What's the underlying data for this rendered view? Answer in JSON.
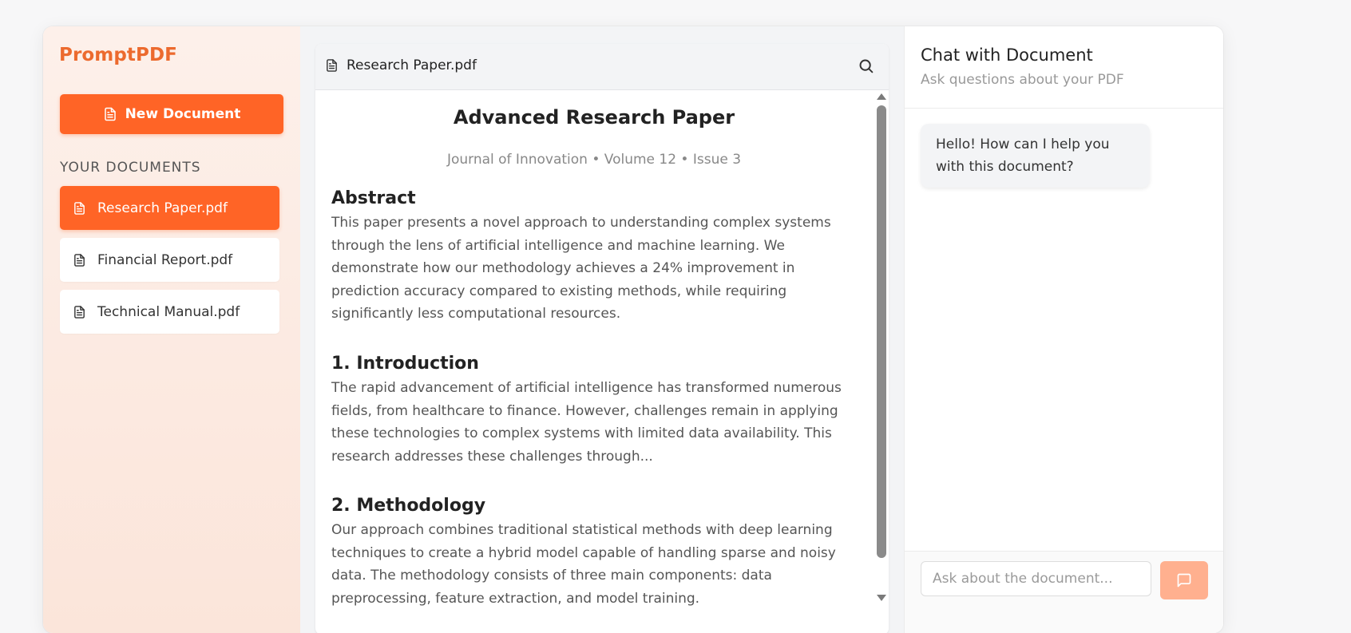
{
  "app": {
    "name": "PromptPDF"
  },
  "sidebar": {
    "new_document_label": "New Document",
    "section_title": "YOUR DOCUMENTS",
    "documents": [
      {
        "name": "Research Paper.pdf",
        "active": true
      },
      {
        "name": "Financial Report.pdf",
        "active": false
      },
      {
        "name": "Technical Manual.pdf",
        "active": false
      }
    ]
  },
  "viewer": {
    "file_name": "Research Paper.pdf",
    "search_icon": "search-icon",
    "document": {
      "title": "Advanced Research Paper",
      "meta": "Journal of Innovation • Volume 12 • Issue 3",
      "sections": [
        {
          "heading": "Abstract",
          "text": "This paper presents a novel approach to understanding complex systems through the lens of artificial intelligence and machine learning. We demonstrate how our methodology achieves a 24% improvement in prediction accuracy compared to existing methods, while requiring significantly less computational resources."
        },
        {
          "heading": "1. Introduction",
          "text": "The rapid advancement of artificial intelligence has transformed numerous fields, from healthcare to finance. However, challenges remain in applying these technologies to complex systems with limited data availability. This research addresses these challenges through..."
        },
        {
          "heading": "2. Methodology",
          "text": "Our approach combines traditional statistical methods with deep learning techniques to create a hybrid model capable of handling sparse and noisy data. The methodology consists of three main components: data preprocessing, feature extraction, and model training."
        }
      ]
    }
  },
  "chat": {
    "title": "Chat with Document",
    "subtitle": "Ask questions about your PDF",
    "messages": [
      {
        "role": "assistant",
        "text": "Hello! How can I help you with this document?"
      }
    ],
    "input_placeholder": "Ask about the document...",
    "input_value": ""
  },
  "colors": {
    "accent": "#ff6426",
    "brand": "#ec6a2e",
    "send_button": "#ffb08f"
  }
}
